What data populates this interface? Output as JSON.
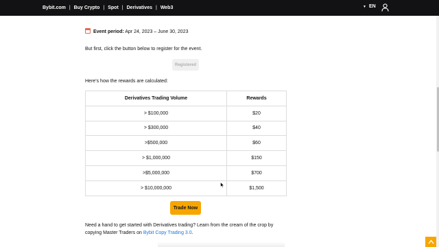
{
  "topbar": {
    "nav": [
      "Bybit.com",
      "Buy Crypto",
      "Spot",
      "Derivatives",
      "Web3"
    ],
    "separator": "|",
    "language": "EN"
  },
  "event": {
    "label": "Event period:",
    "dates": "Apr 24, 2023 – June 30, 2023"
  },
  "register_text": "But first, click the button below to register for the event.",
  "registered_button": "Registered",
  "calc_text": "Here’s how the rewards are calculated:",
  "table": {
    "headers": [
      "Derivatives Trading Volume",
      "Rewards"
    ],
    "rows": [
      [
        "> $100,000",
        "$20"
      ],
      [
        "> $300,000",
        "$40"
      ],
      [
        ">$500,000",
        "$60"
      ],
      [
        "> $1,000,000",
        "$150"
      ],
      [
        ">$5,000,000",
        "$700"
      ],
      [
        "> $10,000,000",
        "$1,500"
      ]
    ]
  },
  "trade_button": "Trade Now",
  "help": {
    "text": "Need a hand to get started with Derivatives trading? Learn from the cream of the crop by copying Master Traders on ",
    "link": "Bybit Copy Trading 3.0",
    "end": "."
  },
  "colors": {
    "topbar_bg": "#121214",
    "accent": "#f7a600",
    "link": "#1b74d8"
  }
}
